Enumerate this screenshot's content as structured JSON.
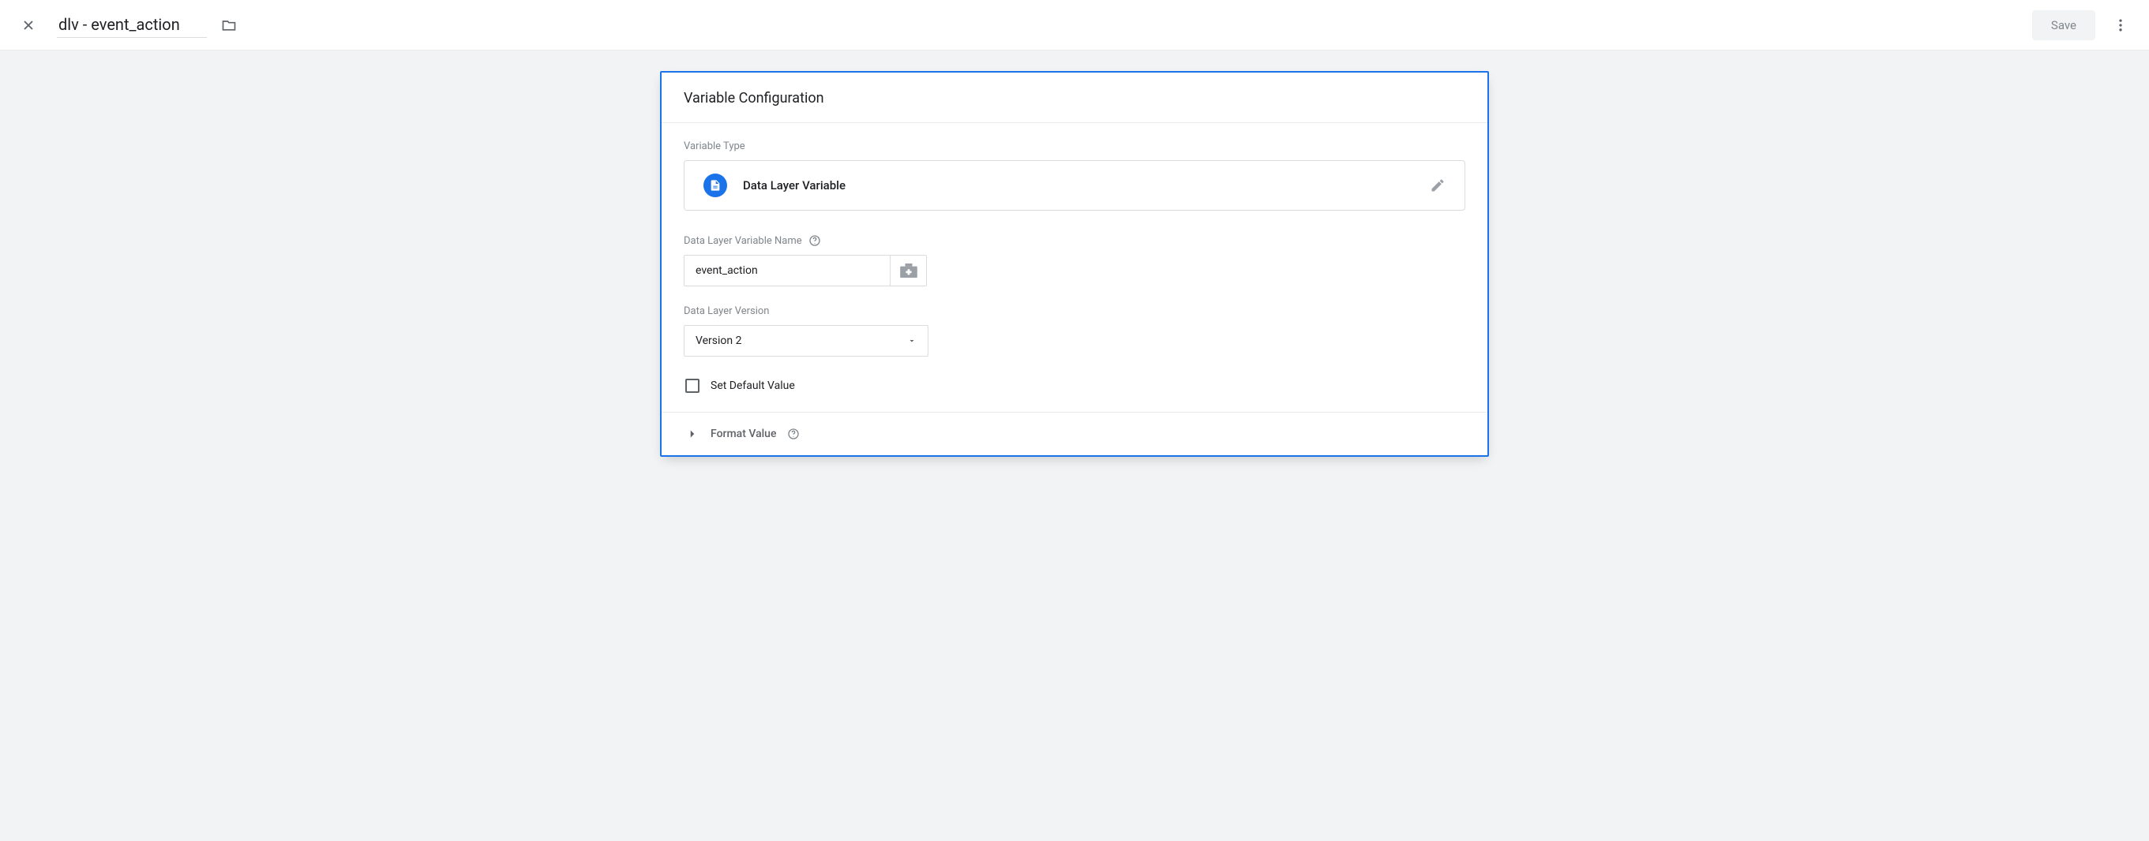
{
  "header": {
    "title": "dlv - event_action",
    "save_label": "Save"
  },
  "panel": {
    "title": "Variable Configuration",
    "variable_type_label": "Variable Type",
    "variable_type_name": "Data Layer Variable",
    "name_label": "Data Layer Variable Name",
    "name_value": "event_action",
    "version_label": "Data Layer Version",
    "version_value": "Version 2",
    "default_checkbox_label": "Set Default Value",
    "format_label": "Format Value"
  }
}
